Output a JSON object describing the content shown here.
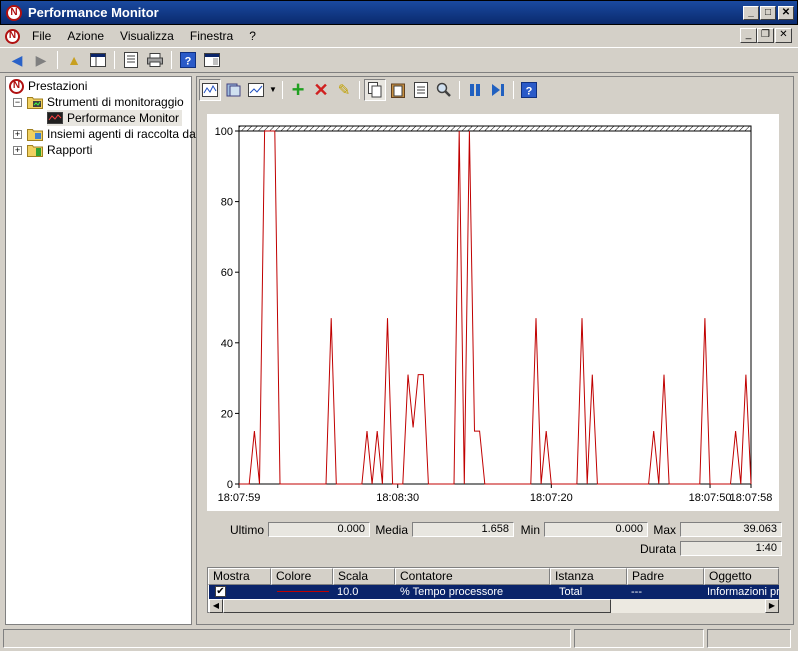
{
  "window": {
    "title": "Performance Monitor",
    "controls": {
      "minimize": "_",
      "maximize": "□",
      "close": "✕"
    }
  },
  "menu": [
    "File",
    "Azione",
    "Visualizza",
    "Finestra",
    "?"
  ],
  "mdi_controls": {
    "minimize": "_",
    "restore": "❐",
    "close": "✕"
  },
  "tree": {
    "root": "Prestazioni",
    "items": [
      {
        "label": "Strumenti di monitoraggio",
        "expander": "−"
      },
      {
        "label": "Performance Monitor"
      },
      {
        "label": "Insiemi agenti di raccolta dati",
        "expander": "+"
      },
      {
        "label": "Rapporti",
        "expander": "+"
      }
    ]
  },
  "stats": {
    "ultimo_label": "Ultimo",
    "ultimo": "0.000",
    "media_label": "Media",
    "media": "1.658",
    "min_label": "Min",
    "min": "0.000",
    "max_label": "Max",
    "max": "39.063",
    "durata_label": "Durata",
    "durata": "1:40"
  },
  "counter_table": {
    "columns": [
      "Mostra",
      "Colore",
      "Scala",
      "Contatore",
      "Istanza",
      "Padre",
      "Oggetto"
    ],
    "rows": [
      {
        "mostra": "✔",
        "colore": "#c00000",
        "scala": "10.0",
        "contatore": "% Tempo processore",
        "istanza": "Total",
        "padre": "---",
        "oggetto": "Informazioni pr"
      }
    ]
  },
  "chart_data": {
    "type": "line",
    "ylim": [
      0,
      100
    ],
    "yticks": [
      "0",
      "20",
      "40",
      "60",
      "80",
      "100"
    ],
    "xticks": [
      "18:07:59",
      "18:08:30",
      "18:07:20",
      "18:07:50",
      "18:07:58"
    ],
    "series": [
      {
        "color": "#c00000",
        "x": [
          0,
          2,
          3,
          4,
          5,
          6,
          7,
          8,
          9,
          10,
          11,
          12,
          13,
          14,
          15,
          16,
          17,
          18,
          19,
          20,
          21,
          22,
          23,
          24,
          25,
          26,
          27,
          28,
          29,
          30,
          31,
          32,
          33,
          34,
          35,
          36,
          37,
          38,
          39,
          40,
          41,
          42,
          43,
          44,
          45,
          46,
          47,
          48,
          49,
          50,
          51,
          52,
          53,
          54,
          55,
          56,
          57,
          58,
          59,
          60,
          61,
          62,
          63,
          64,
          65,
          66,
          67,
          68,
          69,
          70,
          71,
          72,
          73,
          74,
          75,
          76,
          77,
          78,
          79,
          80,
          81,
          82,
          83,
          84,
          85,
          86,
          87,
          88,
          89,
          90,
          91,
          92,
          93,
          94,
          95,
          96,
          97,
          98,
          99,
          100
        ],
        "y": [
          0,
          0,
          15,
          0,
          100,
          100,
          100,
          0,
          0,
          0,
          0,
          0,
          0,
          0,
          0,
          0,
          0,
          47,
          0,
          0,
          0,
          0,
          0,
          0,
          15,
          0,
          15,
          0,
          47,
          0,
          0,
          0,
          31,
          16,
          31,
          31,
          0,
          0,
          0,
          0,
          0,
          0,
          100,
          0,
          100,
          15,
          15,
          0,
          0,
          0,
          0,
          0,
          0,
          0,
          0,
          0,
          0,
          47,
          0,
          15,
          0,
          0,
          0,
          0,
          0,
          0,
          47,
          0,
          31,
          0,
          0,
          0,
          0,
          0,
          0,
          0,
          0,
          0,
          0,
          0,
          15,
          0,
          31,
          0,
          0,
          0,
          0,
          0,
          0,
          0,
          47,
          0,
          0,
          0,
          0,
          0,
          15,
          0,
          31,
          0
        ]
      }
    ]
  }
}
